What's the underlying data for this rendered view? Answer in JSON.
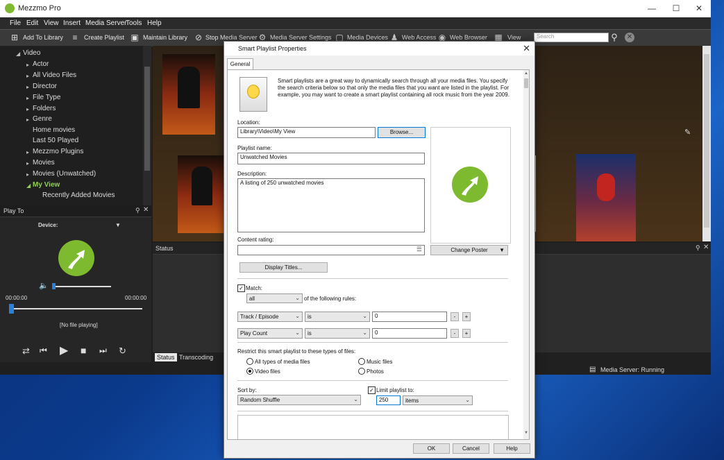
{
  "app": {
    "title": "Mezzmo Pro"
  },
  "menu": [
    "File",
    "Edit",
    "View",
    "Insert",
    "Media Server",
    "Tools",
    "Help"
  ],
  "toolbar": {
    "add_to_library": "Add To Library",
    "create_playlist": "Create Playlist",
    "maintain_library": "Maintain Library",
    "stop_media_server": "Stop Media Server",
    "media_server_settings": "Media Server Settings",
    "media_devices": "Media Devices",
    "web_access": "Web Access",
    "web_browser": "Web Browser",
    "view": "View",
    "search_placeholder": "Search"
  },
  "tree": {
    "root": "Video",
    "items": [
      "Actor",
      "All Video Files",
      "Director",
      "File Type",
      "Folders",
      "Genre",
      "Home movies",
      "Last 50 Played",
      "Mezzmo Plugins",
      "Movies",
      "Movies (Unwatched)",
      "My View"
    ],
    "child": "Recently Added Movies"
  },
  "playto": {
    "header": "Play To",
    "device_label": "Device:",
    "time_start": "00:00:00",
    "time_end": "00:00:00",
    "status": "[No file playing]"
  },
  "status": {
    "header": "Status",
    "tab_status": "Status",
    "tab_transcoding": "Transcoding",
    "server": "Media Server: Running"
  },
  "dialog": {
    "title": "Smart Playlist Properties",
    "tab": "General",
    "intro": "Smart playlists are a great way to dynamically search through all your media files.  You specify the search criteria below so that only the media files that you want are listed in the playlist.  For example, you may want to create a smart playlist containing all rock music from the year 2009.",
    "location_label": "Location:",
    "location_value": "Library\\Video\\My View",
    "browse": "Browse...",
    "name_label": "Playlist name:",
    "name_value": "Unwatched Movies",
    "desc_label": "Description:",
    "desc_value": "A listing of 250 unwatched movies",
    "rating_label": "Content rating:",
    "display_titles": "Display Titles...",
    "change_poster": "Change Poster",
    "match_label": "Match:",
    "match_value": "all",
    "match_suffix": "of the following rules:",
    "rules": [
      {
        "field": "Track / Episode",
        "op": "is",
        "value": "0"
      },
      {
        "field": "Play Count",
        "op": "is",
        "value": "0"
      }
    ],
    "restrict_label": "Restrict this smart playlist to these types of files:",
    "types": {
      "all": "All types of media files",
      "music": "Music files",
      "video": "Video files",
      "photos": "Photos"
    },
    "sort_label": "Sort by:",
    "sort_value": "Random Shuffle",
    "limit_label": "Limit playlist to:",
    "limit_value": "250",
    "limit_unit": "items",
    "ok": "OK",
    "cancel": "Cancel",
    "help": "Help"
  },
  "colors": {
    "accent": "#7dba2f",
    "app_bg": "#1f1f1f",
    "dialog_bg": "#f0f0f0"
  }
}
